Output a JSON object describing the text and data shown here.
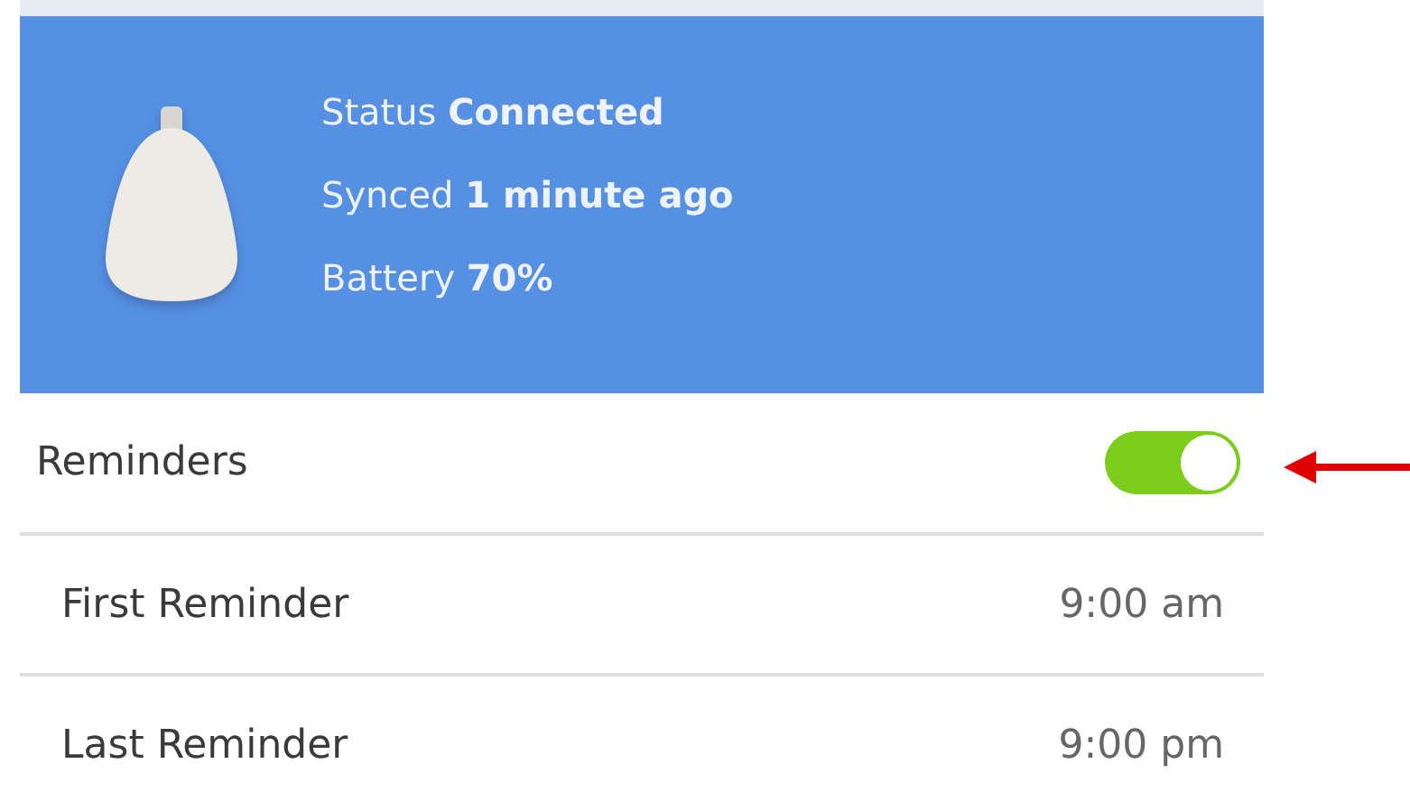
{
  "device": {
    "lines": [
      "Status **Connected**",
      "Synced **1 minute ago**",
      "Battery **70%**"
    ]
  },
  "reminders": {
    "label": "Reminders",
    "on": true
  },
  "rows": [
    {
      "label": "First Reminder",
      "value": "9:00 am"
    },
    {
      "label": "Last Reminder",
      "value": "9:00 pm"
    }
  ]
}
